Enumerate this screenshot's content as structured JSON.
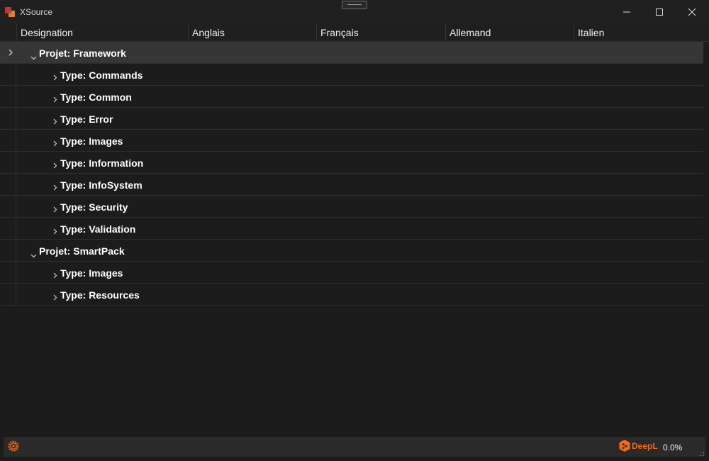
{
  "window": {
    "title": "XSource",
    "accent": "#d24726"
  },
  "grid": {
    "columns": [
      "Designation",
      "Anglais",
      "Français",
      "Allemand",
      "Italien"
    ],
    "rows": [
      {
        "label": "Projet: Framework",
        "level": 0,
        "expanded": true,
        "selected": true
      },
      {
        "label": "Type: Commands",
        "level": 1,
        "expanded": false
      },
      {
        "label": "Type: Common",
        "level": 1,
        "expanded": false
      },
      {
        "label": "Type: Error",
        "level": 1,
        "expanded": false
      },
      {
        "label": "Type: Images",
        "level": 1,
        "expanded": false
      },
      {
        "label": "Type: Information",
        "level": 1,
        "expanded": false
      },
      {
        "label": "Type: InfoSystem",
        "level": 1,
        "expanded": false
      },
      {
        "label": "Type: Security",
        "level": 1,
        "expanded": false
      },
      {
        "label": "Type: Validation",
        "level": 1,
        "expanded": false
      },
      {
        "label": "Projet: SmartPack",
        "level": 0,
        "expanded": true
      },
      {
        "label": "Type: Images",
        "level": 1,
        "expanded": false
      },
      {
        "label": "Type: Resources",
        "level": 1,
        "expanded": false
      }
    ]
  },
  "statusbar": {
    "settings_icon": "gear-icon",
    "brand": "DeepL",
    "brand_color": "#f26a22",
    "progress": "0.0%"
  }
}
